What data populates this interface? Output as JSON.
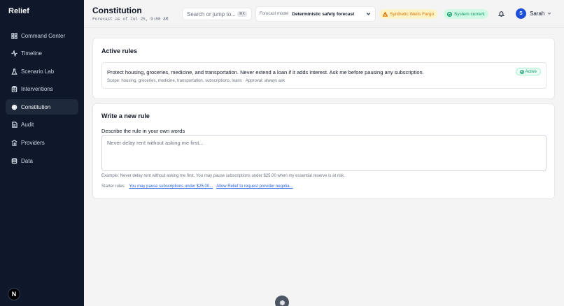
{
  "app": {
    "name": "Relief"
  },
  "sidebar": {
    "items": [
      {
        "label": "Command Center",
        "icon": "grid-icon",
        "active": false
      },
      {
        "label": "Timeline",
        "icon": "activity-icon",
        "active": false
      },
      {
        "label": "Scenario Lab",
        "icon": "flask-icon",
        "active": false
      },
      {
        "label": "Interventions",
        "icon": "clipboard-icon",
        "active": false
      },
      {
        "label": "Constitution",
        "icon": "scale-icon",
        "active": true
      },
      {
        "label": "Audit",
        "icon": "audit-icon",
        "active": false
      },
      {
        "label": "Providers",
        "icon": "bank-icon",
        "active": false
      },
      {
        "label": "Data",
        "icon": "database-icon",
        "active": false
      }
    ],
    "footer_logo": "N"
  },
  "header": {
    "title": "Constitution",
    "subtitle": "Forecast as of Jul 25, 9:00 AM",
    "search": {
      "placeholder": "Search or jump to...",
      "shortcut": "⌘K"
    },
    "forecast_model": {
      "label": "Forecast model",
      "value": "Deterministic safety forecast"
    },
    "status_pills": [
      {
        "label": "Synthetic Wells Fargo",
        "tone": "warning",
        "color": "#d97706"
      },
      {
        "label": "System current",
        "tone": "success",
        "color": "#059669"
      }
    ],
    "user": {
      "initial": "S",
      "name": "Sarah"
    }
  },
  "active_rules": {
    "title": "Active rules",
    "rules": [
      {
        "text": "Protect housing, groceries, medicine, and transportation. Never extend a loan if it adds interest. Ask me before pausing any subscription.",
        "meta": "Scope: housing, groceries, medicine, transportation, subscriptions, loans · Approval: always ask",
        "status": "Active"
      }
    ]
  },
  "new_rule": {
    "title": "Write a new rule",
    "field_label": "Describe the rule in your own words",
    "placeholder": "Never delay rent without asking me first...",
    "value": "",
    "example": "Example: Never delay rent without asking me first. You may pause subscriptions under $25.00 when my essential reserve is at risk.",
    "starter_label": "Starter rules:",
    "starters": [
      "You may pause subscriptions under $25.00...",
      "Allow Relief to request provider negotia..."
    ]
  },
  "colors": {
    "sidebar_bg": "#0f172a",
    "accent": "#2563eb",
    "page_bg": "#f4f4f5"
  }
}
